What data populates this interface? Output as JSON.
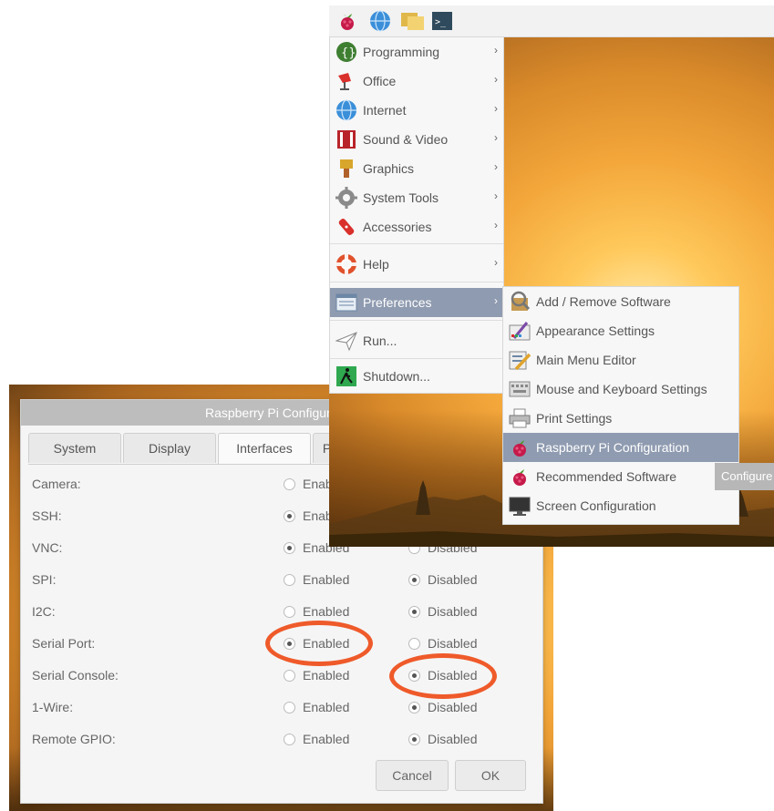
{
  "config_window": {
    "title": "Raspberry Pi Configuration",
    "tabs": [
      {
        "label": "System",
        "active": false
      },
      {
        "label": "Display",
        "active": false
      },
      {
        "label": "Interfaces",
        "active": true
      },
      {
        "label": "Performance",
        "active": false
      }
    ],
    "option_labels": {
      "enabled": "Enabled",
      "disabled": "Disabled"
    },
    "interfaces": [
      {
        "label": "Camera:",
        "value": "Disabled"
      },
      {
        "label": "SSH:",
        "value": "Enabled"
      },
      {
        "label": "VNC:",
        "value": "Enabled"
      },
      {
        "label": "SPI:",
        "value": "Disabled"
      },
      {
        "label": "I2C:",
        "value": "Disabled"
      },
      {
        "label": "Serial Port:",
        "value": "Enabled"
      },
      {
        "label": "Serial Console:",
        "value": "Disabled"
      },
      {
        "label": "1-Wire:",
        "value": "Disabled"
      },
      {
        "label": "Remote GPIO:",
        "value": "Disabled"
      }
    ],
    "buttons": {
      "cancel": "Cancel",
      "ok": "OK"
    },
    "highlights": [
      "Serial Port: Enabled",
      "Serial Console: Disabled"
    ]
  },
  "taskbar": {
    "icons": [
      "raspberry-icon",
      "web-browser-icon",
      "file-manager-icon",
      "terminal-icon"
    ],
    "terminal_glyph": ">_"
  },
  "main_menu": {
    "items": [
      {
        "label": "Programming",
        "icon": "programming-icon",
        "submenu": true
      },
      {
        "label": "Office",
        "icon": "office-icon",
        "submenu": true
      },
      {
        "label": "Internet",
        "icon": "internet-icon",
        "submenu": true
      },
      {
        "label": "Sound & Video",
        "icon": "sound-video-icon",
        "submenu": true
      },
      {
        "label": "Graphics",
        "icon": "graphics-icon",
        "submenu": true
      },
      {
        "label": "System Tools",
        "icon": "system-tools-icon",
        "submenu": true
      },
      {
        "label": "Accessories",
        "icon": "accessories-icon",
        "submenu": true
      },
      {
        "label": "Help",
        "icon": "help-icon",
        "submenu": true
      },
      {
        "label": "Preferences",
        "icon": "preferences-icon",
        "submenu": true,
        "selected": true
      },
      {
        "label": "Run...",
        "icon": "run-icon",
        "submenu": false
      },
      {
        "label": "Shutdown...",
        "icon": "shutdown-icon",
        "submenu": false
      }
    ],
    "arrow": "›"
  },
  "preferences_menu": {
    "items": [
      {
        "label": "Add / Remove Software",
        "icon": "add-remove-software-icon"
      },
      {
        "label": "Appearance Settings",
        "icon": "appearance-settings-icon"
      },
      {
        "label": "Main Menu Editor",
        "icon": "main-menu-editor-icon"
      },
      {
        "label": "Mouse and Keyboard Settings",
        "icon": "mouse-keyboard-icon"
      },
      {
        "label": "Print Settings",
        "icon": "print-settings-icon"
      },
      {
        "label": "Raspberry Pi Configuration",
        "icon": "raspberry-icon",
        "selected": true
      },
      {
        "label": "Recommended Software",
        "icon": "raspberry-icon"
      },
      {
        "label": "Screen Configuration",
        "icon": "screen-configuration-icon"
      }
    ]
  },
  "tooltip": {
    "text": "Configure"
  },
  "colors": {
    "menu_selected": "#8f9bb0",
    "highlight_ring": "#ef5a2a",
    "raspberry": "#c51a4a"
  }
}
